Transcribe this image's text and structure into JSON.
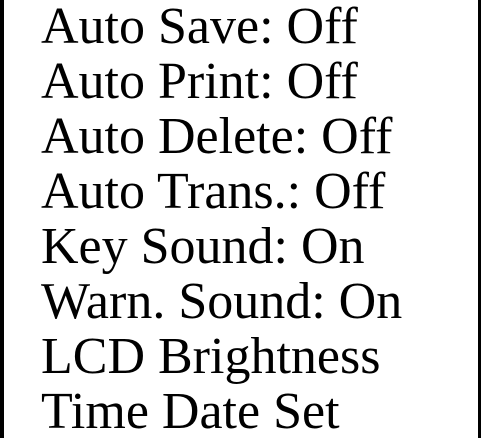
{
  "menu": {
    "items": [
      {
        "label": "Auto Save: Off"
      },
      {
        "label": "Auto Print: Off"
      },
      {
        "label": "Auto Delete: Off"
      },
      {
        "label": "Auto Trans.: Off"
      },
      {
        "label": "Key Sound: On"
      },
      {
        "label": "Warn. Sound: On"
      },
      {
        "label": "LCD Brightness"
      },
      {
        "label": "Time Date Set"
      }
    ]
  },
  "colors": {
    "background": "#ffffff",
    "text": "#000000",
    "border": "#000000"
  }
}
